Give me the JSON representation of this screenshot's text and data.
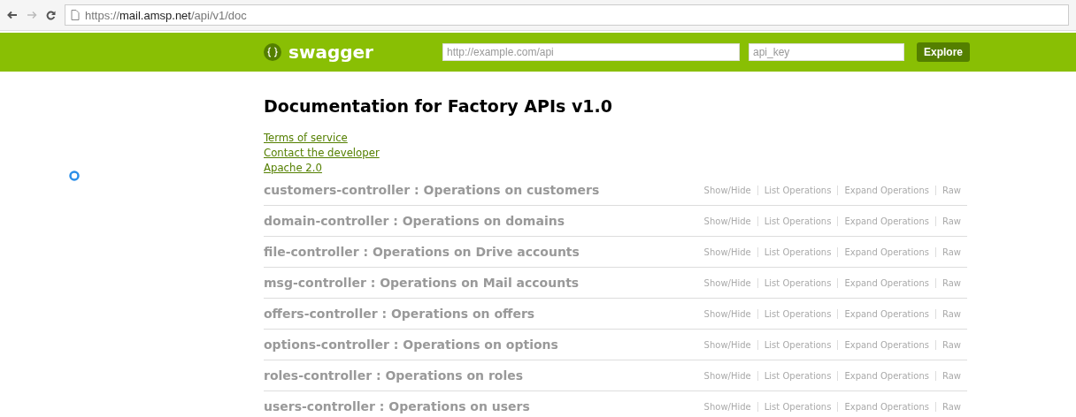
{
  "browser": {
    "url": "https://**mail.amsp.net**/api/v1/doc"
  },
  "header": {
    "logo": "swagger",
    "url_field": {
      "placeholder": "http://example.com/api"
    },
    "key_field": {
      "placeholder": "api_key"
    },
    "button": "Explore"
  },
  "title": "Documentation for Factory APIs v1.0",
  "links": [
    "Terms of service",
    "Contact the developer",
    "Apache 2.0"
  ],
  "resources": [
    {
      "name": "customers-controller : Operations on customers",
      "actions": [
        "Show/Hide",
        "List Operations",
        "Expand Operations",
        "Raw"
      ]
    },
    {
      "name": "domain-controller : Operations on domains",
      "actions": [
        "Show/Hide",
        "List Operations",
        "Expand Operations",
        "Raw"
      ]
    },
    {
      "name": "file-controller : Operations on Drive accounts",
      "actions": [
        "Show/Hide",
        "List Operations",
        "Expand Operations",
        "Raw"
      ]
    },
    {
      "name": "msg-controller : Operations on Mail accounts",
      "actions": [
        "Show/Hide",
        "List Operations",
        "Expand Operations",
        "Raw"
      ]
    },
    {
      "name": "offers-controller : Operations on offers",
      "actions": [
        "Show/Hide",
        "List Operations",
        "Expand Operations",
        "Raw"
      ]
    },
    {
      "name": "options-controller : Operations on options",
      "actions": [
        "Show/Hide",
        "List Operations",
        "Expand Operations",
        "Raw"
      ]
    },
    {
      "name": "roles-controller : Operations on roles",
      "actions": [
        "Show/Hide",
        "List Operations",
        "Expand Operations",
        "Raw"
      ]
    },
    {
      "name": "users-controller : Operations on users",
      "actions": [
        "Show/Hide",
        "List Operations",
        "Expand Operations",
        "Raw"
      ]
    }
  ]
}
